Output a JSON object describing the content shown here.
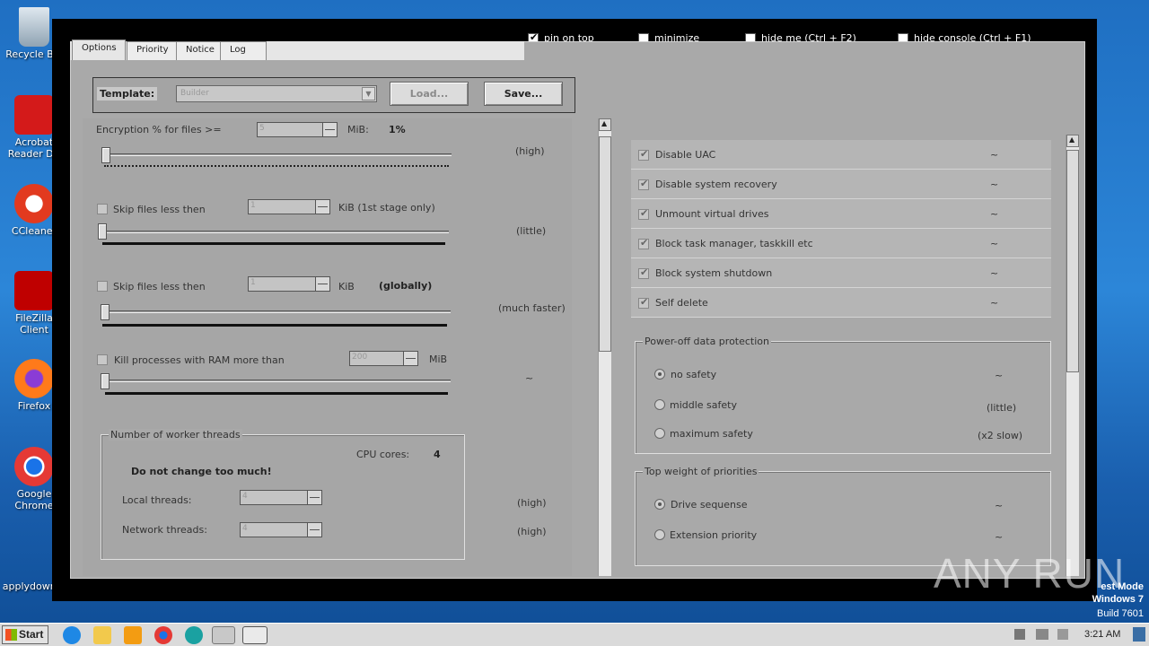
{
  "desktop": {
    "icons": [
      "Recycle Bin",
      "Acrobat Reader DC",
      "CCleaner",
      "FileZilla Client",
      "Firefox",
      "Google Chrome",
      "applydown..."
    ]
  },
  "window": {
    "top_checkboxes": [
      {
        "label": "pin on top",
        "checked": true
      },
      {
        "label": "minimize",
        "checked": false
      },
      {
        "label": "hide me (Ctrl + F2)",
        "checked": false
      },
      {
        "label": "hide console (Ctrl + F1)",
        "checked": false
      }
    ],
    "tabs": [
      "Options",
      "Priority",
      "Notice",
      "Log"
    ],
    "template": {
      "label": "Template:",
      "value": "Builder",
      "load": "Load...",
      "save": "Save..."
    },
    "left": {
      "encryption": {
        "label": "Encryption % for files >=",
        "value": "5",
        "unit": "MiB:",
        "percent": "1%",
        "right": "(high)"
      },
      "skip1": {
        "label": "Skip files less then",
        "value": "1",
        "unit": "KiB (1st stage only)",
        "right": "(little)"
      },
      "skip2": {
        "label": "Skip files less then",
        "value": "1",
        "unit": "KiB",
        "note": "(globally)",
        "right": "(much faster)"
      },
      "kill": {
        "label": "Kill processes with RAM more than",
        "value": "200",
        "unit": "MiB",
        "right": "~"
      },
      "threads": {
        "title": "Number of worker threads",
        "cpu_label": "CPU cores:",
        "cpu_value": "4",
        "warning": "Do not change too much!",
        "local_label": "Local threads:",
        "local_value": "4",
        "local_right": "(high)",
        "network_label": "Network threads:",
        "network_value": "4",
        "network_right": "(high)"
      }
    },
    "right": {
      "features": [
        {
          "label": "Disable UAC",
          "tilde": "~"
        },
        {
          "label": "Disable system recovery",
          "tilde": "~"
        },
        {
          "label": "Unmount virtual drives",
          "tilde": "~"
        },
        {
          "label": "Block task manager, taskkill etc",
          "tilde": "~"
        },
        {
          "label": "Block system shutdown",
          "tilde": "~"
        },
        {
          "label": "Self delete",
          "tilde": "~"
        }
      ],
      "poweroff": {
        "title": "Power-off data protection",
        "options": [
          {
            "label": "no safety",
            "right": "~",
            "selected": true
          },
          {
            "label": "middle safety",
            "right": "(little)",
            "selected": false
          },
          {
            "label": "maximum safety",
            "right": "(x2 slow)",
            "selected": false
          }
        ]
      },
      "weight": {
        "title": "Top weight of priorities",
        "options": [
          {
            "label": "Drive sequense",
            "right": "~",
            "selected": true
          },
          {
            "label": "Extension priority",
            "right": "~",
            "selected": false
          }
        ]
      }
    }
  },
  "overlay": {
    "watermark": "ANY RUN",
    "testmode": [
      "est Mode",
      "Windows 7",
      "Build 7601"
    ]
  },
  "taskbar": {
    "start": "Start",
    "clock": "3:21 AM"
  }
}
